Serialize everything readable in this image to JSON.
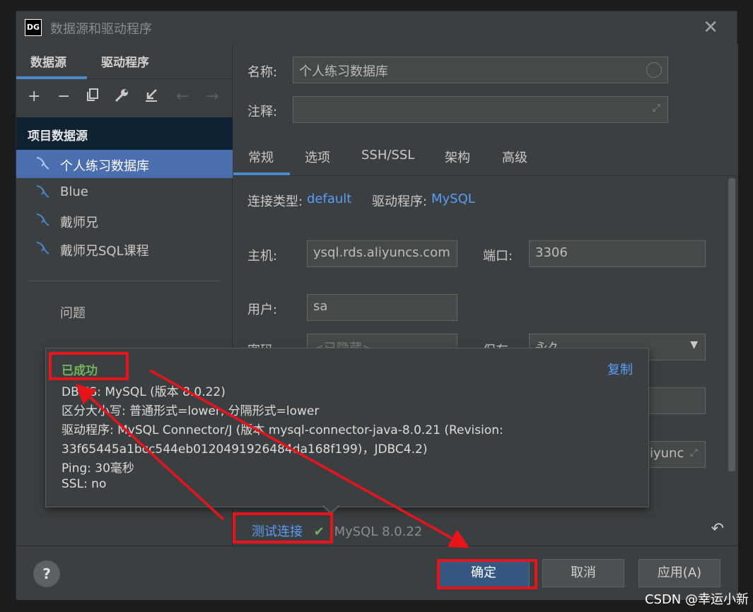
{
  "window": {
    "title": "数据源和驱动程序",
    "app_icon": "DG"
  },
  "left_tabs": [
    "数据源",
    "驱动程序"
  ],
  "toolbar_icons": [
    "plus-icon",
    "minus-icon",
    "duplicate-icon",
    "wrench-icon",
    "import-icon",
    "back-arrow-icon",
    "forward-arrow-icon"
  ],
  "sidebar": {
    "group_header": "项目数据源",
    "items": [
      {
        "label": "个人练习数据库",
        "selected": true
      },
      {
        "label": "Blue"
      },
      {
        "label": "戴师兄"
      },
      {
        "label": "戴师兄SQL课程"
      }
    ],
    "problems_label": "问题"
  },
  "form": {
    "name_label": "名称:",
    "name_value": "个人练习数据库",
    "comment_label": "注释:",
    "tabs": [
      "常规",
      "选项",
      "SSH/SSL",
      "架构",
      "高级"
    ],
    "conn_type_label": "连接类型:",
    "conn_type_value": "default",
    "driver_label": "驱动程序:",
    "driver_value": "MySQL",
    "host_label": "主机:",
    "host_value": "ysql.rds.aliyuncs.com",
    "port_label": "端口:",
    "port_value": "3306",
    "user_label": "用户:",
    "user_value": "sa",
    "password_label": "密码:",
    "password_placeholder": "<已隐藏>",
    "save_label": "保存:",
    "save_value": "永久",
    "url_partial": "iyunc"
  },
  "popup": {
    "status": "已成功",
    "copy_label": "复制",
    "lines": [
      "DBMS: MySQL (版本 8.0.22)",
      "区分大小写: 普通形式=lower, 分隔形式=lower",
      "驱动程序: MySQL Connector/J (版本 mysql-connector-java-8.0.21 (Revision:",
      "33f65445a1bcc544eb0120491926484da168f199)，JDBC4.2)",
      "Ping: 30毫秒",
      "SSL: no"
    ]
  },
  "test": {
    "label": "测试连接",
    "result": "MySQL 8.0.22"
  },
  "buttons": {
    "help": "?",
    "ok": "确定",
    "cancel": "取消",
    "apply": "应用(A)"
  },
  "watermark": "CSDN @幸运小新",
  "colors": {
    "accent": "#4a88c7",
    "selection": "#4b6eaf",
    "success": "#6fb35a",
    "link": "#589df6",
    "annotation": "#e8141c"
  }
}
